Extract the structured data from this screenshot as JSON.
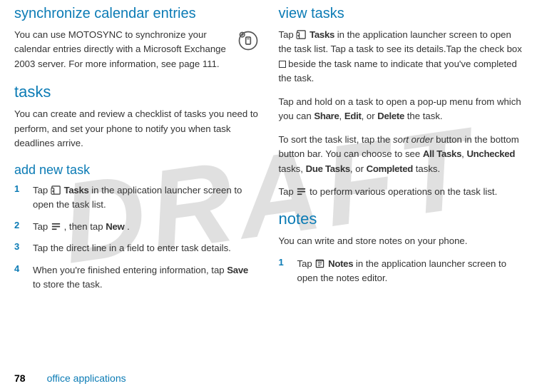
{
  "watermark": "DRAFT",
  "left": {
    "h_sync": "synchronize calendar entries",
    "p_sync": "You can use MOTOSYNC to synchronize your calendar entries directly with a Microsoft Exchange 2003 server. For more information, see page 111.",
    "h_tasks": "tasks",
    "p_tasks": "You can create and review a checklist of tasks you need to perform, and set your phone to notify you when task deadlines arrive.",
    "h_addnew": "add new task",
    "steps": [
      {
        "num": "1",
        "pre": "Tap ",
        "bold": "Tasks",
        "post": " in the application launcher screen to open the task list."
      },
      {
        "num": "2",
        "pre": "Tap ",
        "mid": ", then tap ",
        "bold2": "New",
        "post": "."
      },
      {
        "num": "3",
        "text": "Tap the direct line in a field to enter task details."
      },
      {
        "num": "4",
        "pre": "When you're finished entering information, tap ",
        "bold": "Save",
        "post": " to store the task."
      }
    ]
  },
  "right": {
    "h_view": "view tasks",
    "p_view_pre": "Tap ",
    "p_view_bold": "Tasks",
    "p_view_post": " in the application launcher screen to open the task list. Tap a task to see its details.Tap the check box ",
    "p_view_post2": " beside the task name to indicate that you've completed the task.",
    "p_hold_pre": "Tap and hold on a task to open a pop-up menu from which you can ",
    "share": "Share",
    "edit": "Edit",
    "delete": "Delete",
    "p_hold_post": " the task.",
    "p_sort_pre": "To sort the task list, tap the ",
    "sort_order": "sort order",
    "p_sort_mid": " button in the bottom button bar. You can choose to see ",
    "alltasks": "All Tasks",
    "unchecked": "Unchecked",
    "duetasks": "Due Tasks",
    "completed": "Completed",
    "p_sort_post": " tasks.",
    "p_menu_pre": "Tap ",
    "p_menu_post": " to perform various operations on the task list.",
    "h_notes": "notes",
    "p_notes": "You can write and store notes on your phone.",
    "steps": [
      {
        "num": "1",
        "pre": "Tap ",
        "bold": "Notes",
        "post": " in the application launcher screen to open the notes editor."
      }
    ]
  },
  "footer": {
    "page": "78",
    "title": "office applications"
  }
}
